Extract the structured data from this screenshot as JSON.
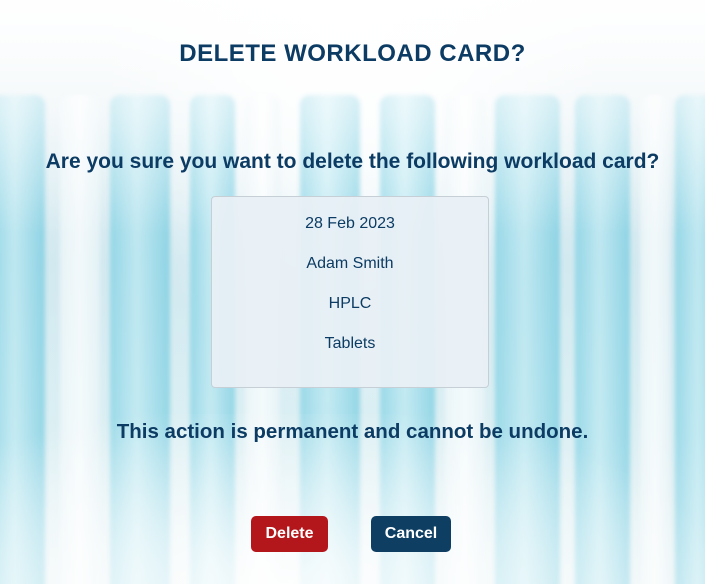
{
  "dialog": {
    "title": "DELETE WORKLOAD CARD?",
    "question": "Are you sure you want to delete the following workload card?",
    "card": {
      "date": "28 Feb 2023",
      "name": "Adam Smith",
      "instrument": "HPLC",
      "product": "Tablets"
    },
    "warning": "This action is permanent and cannot be undone.",
    "buttons": {
      "delete_label": "Delete",
      "cancel_label": "Cancel"
    }
  },
  "colors": {
    "primary_text": "#0c3b63",
    "delete_button": "#b4171b",
    "cancel_button": "#0e3f63",
    "card_background": "#e8f0f5"
  },
  "background": {
    "description_icon": "lab-test-tubes-background"
  }
}
